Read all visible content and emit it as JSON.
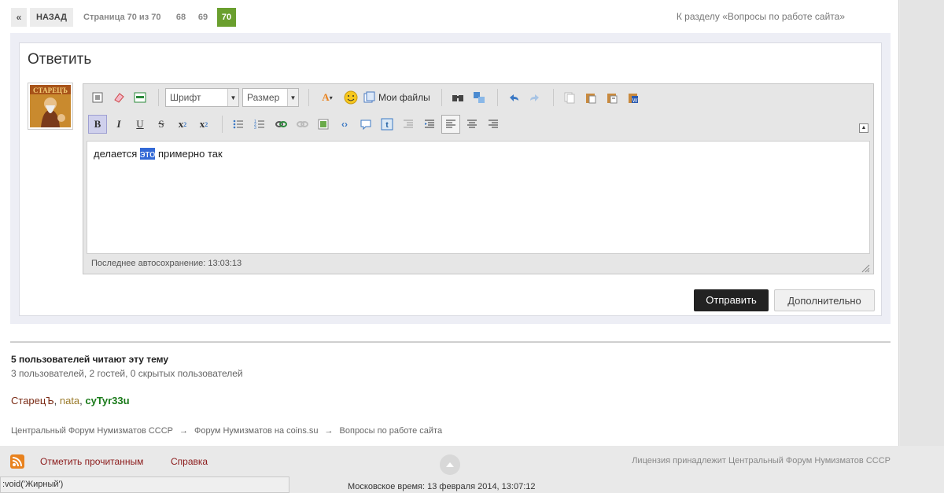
{
  "pagination": {
    "first": "«",
    "back": "НАЗАД",
    "info": "Страница 70 из 70",
    "pages": [
      "68",
      "69",
      "70"
    ],
    "current": "70",
    "section_link": "К разделу «Вопросы по работе сайта»"
  },
  "reply": {
    "title": "Ответить",
    "toolbar": {
      "font_label": "Шрифт",
      "size_label": "Размер",
      "my_files_label": "Мои файлы"
    },
    "editor": {
      "text_before": "делается",
      "text_selected": "это",
      "text_after": "примерно так"
    },
    "autosave": "Последнее автосохранение: 13:03:13",
    "submit_label": "Отправить",
    "more_label": "Дополнительно"
  },
  "readers": {
    "title": "5 пользователей читают эту тему",
    "detail": "3 пользователей, 2 гостей, 0 скрытых пользователей",
    "users": [
      "СтарецЪ",
      "nata",
      "cyTyr33u"
    ]
  },
  "breadcrumb": [
    "Центральный Форум Нумизматов СССР",
    "Форум Нумизматов на coins.su",
    "Вопросы по работе сайта"
  ],
  "footer": {
    "mark_read": "Отметить прочитанным",
    "help": "Справка",
    "license": "Лицензия принадлежит Центральный Форум Нумизматов СССР",
    "status": ":void('Жирный')",
    "time": "Московское время: 13 февраля 2014, 13:07:12"
  },
  "colors": {
    "accent_green": "#6a9f2e",
    "selection": "#3369d6",
    "submit_bg": "#222222",
    "link_red": "#8b1a1a"
  }
}
